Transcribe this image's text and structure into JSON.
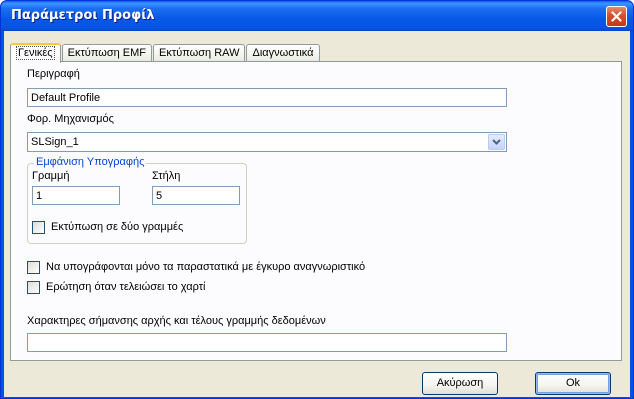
{
  "window": {
    "title": "Παράμετροι Προφίλ"
  },
  "tabs": [
    {
      "label": "Γενικές",
      "active": true
    },
    {
      "label": "Εκτύπωση EMF",
      "active": false
    },
    {
      "label": "Εκτύπωση RAW",
      "active": false
    },
    {
      "label": "Διαγνωστικά",
      "active": false
    }
  ],
  "general": {
    "description_label": "Περιγραφή",
    "description_value": "Default Profile",
    "fiscal_device_label": "Φορ. Μηχανισμός",
    "fiscal_device_value": "SLSign_1",
    "signature_group_title": "Εμφάνιση Υπογραφής",
    "line_label": "Γραμμή",
    "line_value": "1",
    "column_label": "Στήλη",
    "column_value": "5",
    "two_lines_label": "Εκτύπωση σε δύο γραμμές",
    "two_lines_checked": false,
    "valid_only_label": "Να υπογράφονται μόνο τα παραστατικά με έγκυρο αναγνωριστικό",
    "valid_only_checked": false,
    "ask_paper_label": "Ερώτηση όταν τελειώσει το χαρτί",
    "ask_paper_checked": false,
    "markers_label": "Χαρακτηρες σήμανσης αρχής και τέλους γραμμής δεδομένων",
    "markers_value": ""
  },
  "buttons": {
    "cancel": "Ακύρωση",
    "ok": "Ok"
  },
  "colors": {
    "titlebar": "#0858e6",
    "dialog_bg": "#ece9d8",
    "group_title": "#0046d5",
    "active_tab_accent": "#ffc83c"
  }
}
